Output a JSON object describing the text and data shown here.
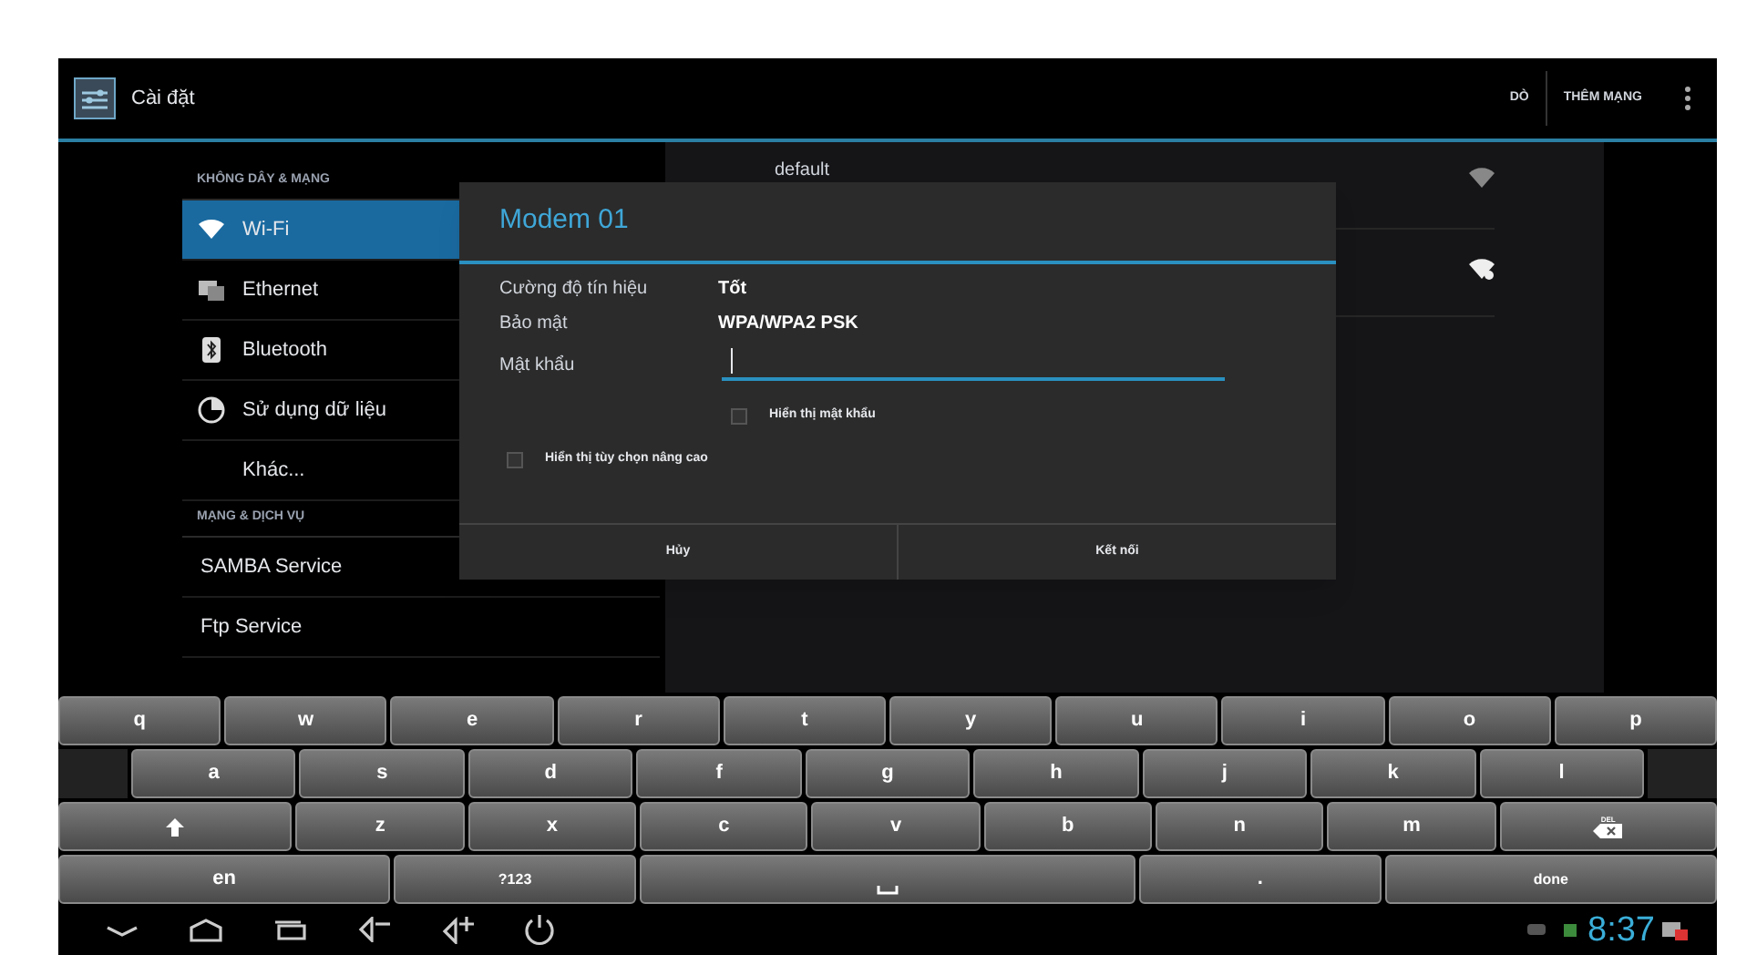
{
  "action_bar": {
    "title": "Cài đặt",
    "actions": [
      "DÒ",
      "THÊM MẠNG"
    ]
  },
  "sidebar": {
    "sections": [
      {
        "header": "KHÔNG DÂY & MẠNG",
        "items": [
          {
            "label": "Wi-Fi",
            "kind": "wifi",
            "selected": true
          },
          {
            "label": "Ethernet",
            "kind": "ethernet",
            "selected": false
          },
          {
            "label": "Bluetooth",
            "kind": "bluetooth",
            "selected": false
          },
          {
            "label": "Sử dụng dữ liệu",
            "kind": "data",
            "selected": false
          },
          {
            "label": "Khác...",
            "kind": "indented",
            "selected": false
          }
        ]
      },
      {
        "header": "MẠNG & DỊCH VỤ",
        "items": [
          {
            "label": "SAMBA Service",
            "kind": "plain",
            "selected": false
          },
          {
            "label": "Ftp Service",
            "kind": "plain",
            "selected": false
          }
        ]
      }
    ]
  },
  "network_list": [
    {
      "name": "default",
      "locked": false
    },
    {
      "locked": true
    }
  ],
  "dialog": {
    "title": "Modem 01",
    "rows": [
      {
        "label": "Cường độ tín hiệu",
        "value": "Tốt"
      },
      {
        "label": "Bảo mật",
        "value": "WPA/WPA2 PSK"
      }
    ],
    "password_label": "Mật khẩu",
    "checkboxes": [
      {
        "label": "Hiển thị mật khẩu",
        "checked": false
      },
      {
        "label": "Hiển thị tùy chọn nâng cao",
        "checked": false
      }
    ],
    "buttons": [
      "Hủy",
      "Kết nối"
    ]
  },
  "keyboard": {
    "rows": [
      [
        {
          "kind": "char",
          "label": "q"
        },
        {
          "kind": "char",
          "label": "w"
        },
        {
          "kind": "char",
          "label": "e"
        },
        {
          "kind": "char",
          "label": "r"
        },
        {
          "kind": "char",
          "label": "t"
        },
        {
          "kind": "char",
          "label": "y"
        },
        {
          "kind": "char",
          "label": "u"
        },
        {
          "kind": "char",
          "label": "i"
        },
        {
          "kind": "char",
          "label": "o"
        },
        {
          "kind": "char",
          "label": "p"
        }
      ],
      [
        {
          "kind": "gap"
        },
        {
          "kind": "char",
          "label": "a"
        },
        {
          "kind": "char",
          "label": "s"
        },
        {
          "kind": "char",
          "label": "d"
        },
        {
          "kind": "char",
          "label": "f"
        },
        {
          "kind": "char",
          "label": "g"
        },
        {
          "kind": "char",
          "label": "h"
        },
        {
          "kind": "char",
          "label": "j"
        },
        {
          "kind": "char",
          "label": "k"
        },
        {
          "kind": "char",
          "label": "l"
        },
        {
          "kind": "gap"
        }
      ],
      [
        {
          "kind": "shift"
        },
        {
          "kind": "char",
          "label": "z"
        },
        {
          "kind": "char",
          "label": "x"
        },
        {
          "kind": "char",
          "label": "c"
        },
        {
          "kind": "char",
          "label": "v"
        },
        {
          "kind": "char",
          "label": "b"
        },
        {
          "kind": "char",
          "label": "n"
        },
        {
          "kind": "char",
          "label": "m"
        },
        {
          "kind": "delete",
          "label": "DEL"
        }
      ],
      [
        {
          "kind": "wide",
          "label": "en"
        },
        {
          "kind": "mid",
          "label": "?123"
        },
        {
          "kind": "space"
        },
        {
          "kind": "mid",
          "label": "."
        },
        {
          "kind": "wide",
          "label": "done"
        }
      ]
    ]
  },
  "status_bar": {
    "time": "8:37"
  }
}
